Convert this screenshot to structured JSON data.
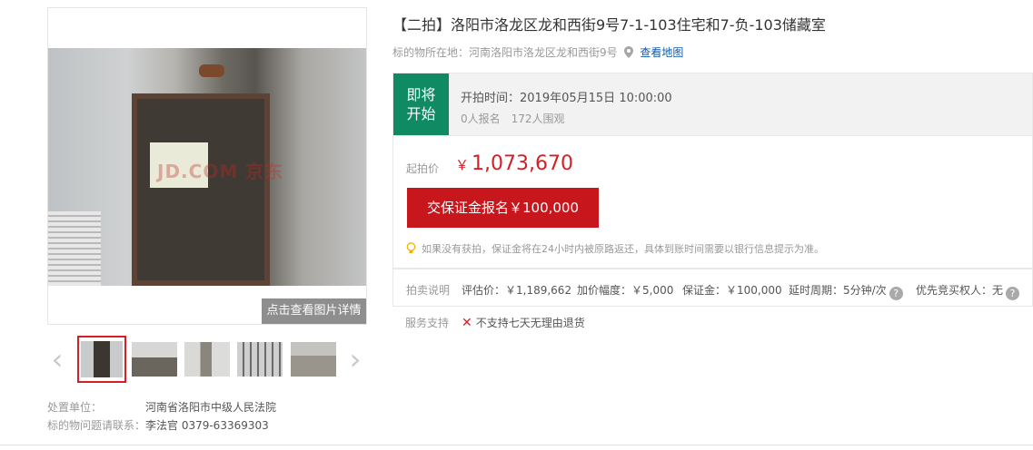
{
  "gallery": {
    "photo_detail_label": "点击查看图片详情",
    "watermark_text": "JD.COM 京东",
    "thumbnails": [
      "thumb-1",
      "thumb-2",
      "thumb-3",
      "thumb-4",
      "thumb-5"
    ],
    "icons": {
      "prev": "chevron-left-icon",
      "next": "chevron-right-icon"
    }
  },
  "seller": {
    "unit_label": "处置单位：",
    "unit_value": "河南省洛阳市中级人民法院",
    "contact_label": "标的物问题请联系：",
    "contact_value": "李法官 0379-63369303"
  },
  "listing": {
    "title": "【二拍】洛阳市洛龙区龙和西街9号7-1-103住宅和7-负-103储藏室",
    "location_label": "标的物所在地：",
    "location_value": "河南洛阳市洛龙区龙和西街9号",
    "map_link": "查看地图"
  },
  "status": {
    "badge_line1": "即将",
    "badge_line2": "开始",
    "start_time_label": "开拍时间：",
    "start_time_value": "2019年05月15日 10:00:00",
    "signup": "0人报名",
    "watchers": "172人围观",
    "badge_color": "#0f8a62"
  },
  "bid": {
    "start_label": "起拍价",
    "currency": "￥",
    "start_price": "1,073,670",
    "deposit_button": "交保证金报名￥100,000",
    "tip": "如果没有获拍，保证金将在24小时内被原路返还，具体到账时间需要以银行信息提示为准。",
    "accent_color": "#c8161d"
  },
  "rules": {
    "label": "拍卖说明",
    "appraisal": "评估价：￥1,189,662",
    "increment": "加价幅度：￥5,000",
    "deposit": "保证金：￥100,000",
    "extension": "延时周期：5分钟/次",
    "priority": "优先竞买权人：无",
    "help_glyph": "?"
  },
  "service": {
    "label": "服务支持",
    "item": "不支持七天无理由退货"
  }
}
